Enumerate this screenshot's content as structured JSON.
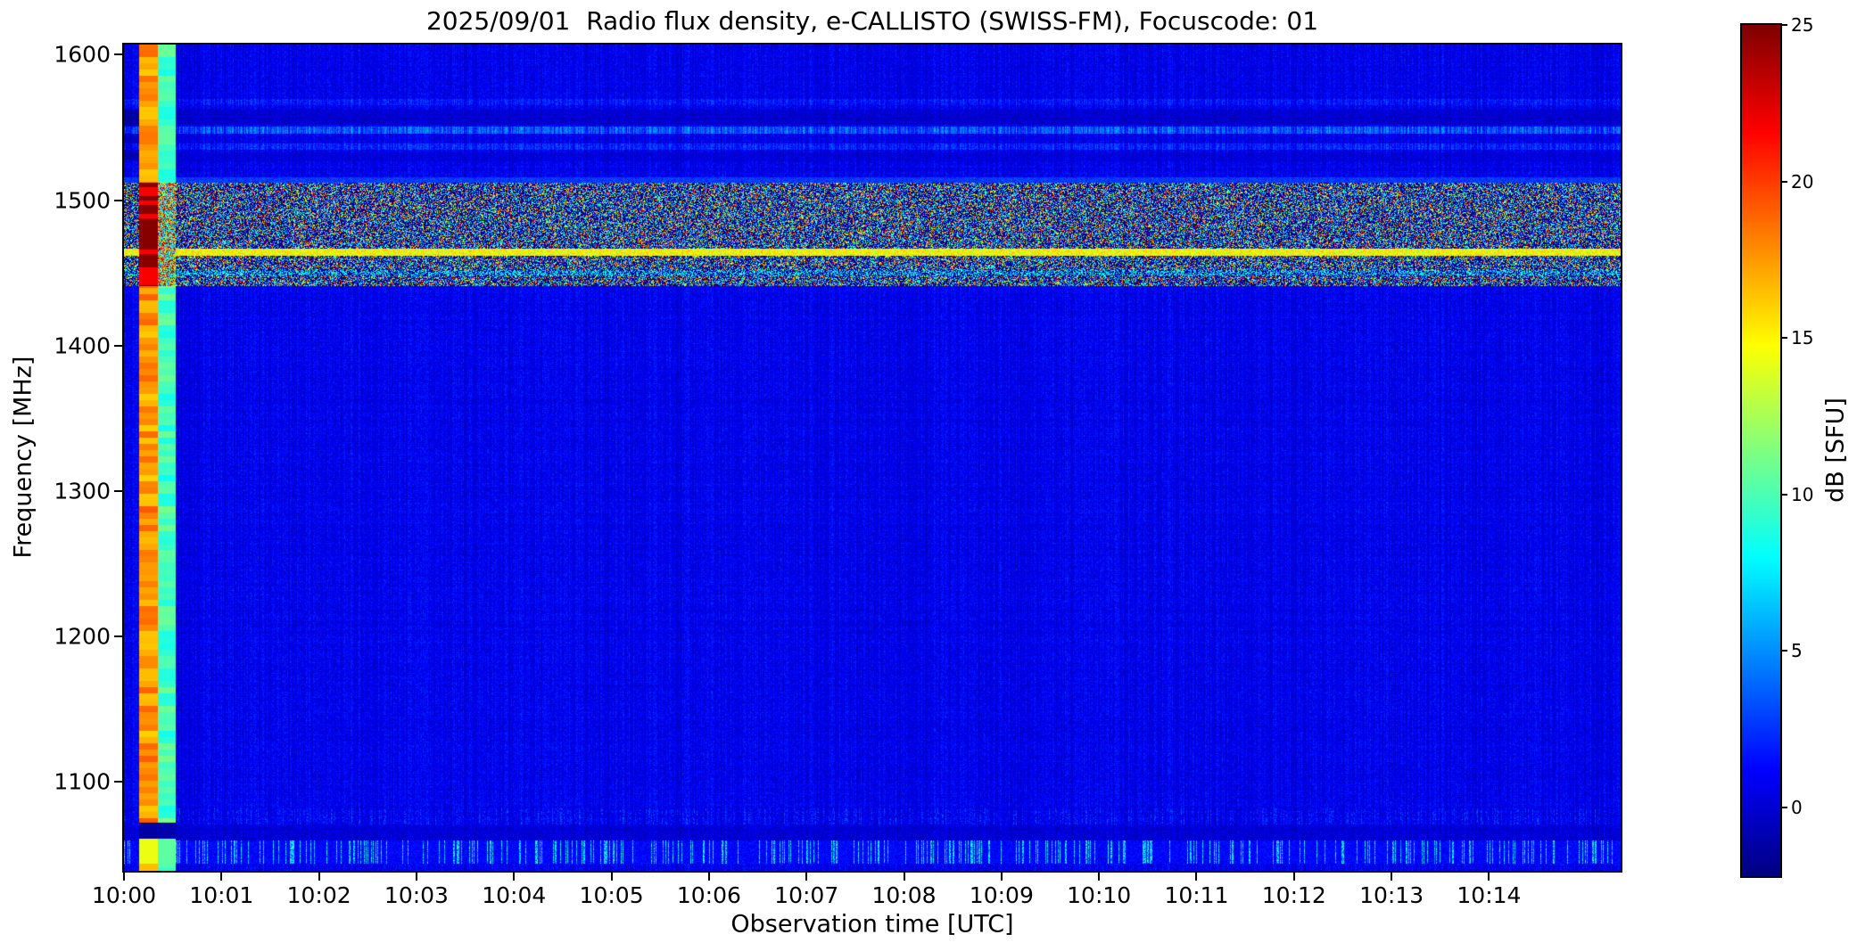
{
  "figure": {
    "title": "2025/09/01  Radio flux density, e-CALLISTO (SWISS-FM), Focuscode: 01",
    "xlabel": "Observation time [UTC]",
    "ylabel": "Frequency [MHz]",
    "colorbar_label": "dB [SFU]"
  },
  "chart_data": {
    "type": "heatmap",
    "title": "2025/09/01  Radio flux density, e-CALLISTO (SWISS-FM), Focuscode: 01",
    "xlabel": "Observation time [UTC]",
    "ylabel": "Frequency [MHz]",
    "x_tick_labels": [
      "10:00",
      "10:01",
      "10:02",
      "10:03",
      "10:04",
      "10:05",
      "10:06",
      "10:07",
      "10:08",
      "10:09",
      "10:10",
      "10:11",
      "10:12",
      "10:13",
      "10:14"
    ],
    "x_tick_minutes": [
      0,
      1,
      2,
      3,
      4,
      5,
      6,
      7,
      8,
      9,
      10,
      11,
      12,
      13,
      14
    ],
    "x_range_min": [
      0,
      15.35
    ],
    "y_tick_values": [
      1600,
      1500,
      1400,
      1300,
      1200,
      1100
    ],
    "y_range_mhz": [
      1039,
      1607
    ],
    "grid": false,
    "colorbar": {
      "label": "dB [SFU]",
      "tick_values": [
        0,
        5,
        10,
        15,
        20,
        25
      ],
      "range_db": [
        -2.2,
        25
      ],
      "colormap": "jet",
      "position": "right"
    },
    "background": {
      "mean_db": 0.7,
      "column_variation_db": 1.4,
      "pixel_noise_db": 2.4,
      "row_variation_db": 0.5
    },
    "features": {
      "pre_cal_dark_band": {
        "time_min": [
          0,
          0.16
        ],
        "freq_mhz": [
          1528,
          1562
        ],
        "boost_db": -1.2
      },
      "cal_stripe_main": {
        "time_min": [
          0.16,
          0.345
        ],
        "level_db": 17.6,
        "block_jitter_db": 1.6,
        "band_freq_mhz": [
          1441,
          1512
        ],
        "band_level_db": [
          21.8,
          24.8
        ],
        "gap_freq_mhz": [
          1061,
          1072
        ],
        "gap_level_db": -1.2,
        "bottom_freq_mhz": [
          1044,
          1061
        ],
        "bottom_level_db": 14.3,
        "below_level_db": 16.5
      },
      "cal_stripe_secondary": {
        "time_min": [
          0.345,
          0.53
        ],
        "level_db": 9.8,
        "block_jitter_db": 1.4,
        "band_freq_mhz": [
          1441,
          1512
        ],
        "band_speckle_fractions": [
          0.28,
          0.55
        ],
        "band_speckle_levels_db": [
          [
            22,
            25
          ],
          [
            13,
            20
          ],
          [
            5,
            11
          ]
        ],
        "gap_freq_mhz": [
          1061,
          1072
        ],
        "gap_level_db": -1.0,
        "bottom_freq_mhz": [
          1044,
          1061
        ],
        "bottom_level_db": 10.5
      },
      "interference_band": {
        "freq_mhz": [
          1441,
          1512
        ],
        "dark_level_db": [
          -2.2,
          -1.3
        ],
        "speckle_fractions": [
          0.48,
          0.75,
          0.93
        ],
        "speckle_levels_db": [
          [
            2.5,
            10.5
          ],
          [
            11,
            20
          ],
          [
            20,
            25
          ]
        ]
      },
      "carrier_line": {
        "freq_mhz": [
          1462,
          1466.5
        ],
        "level_db": [
          12.5,
          17
        ]
      },
      "secondary_line": {
        "freq_mhz": [
          1448.5,
          1452
        ],
        "level_db": [
          4.5,
          10.5
        ],
        "fill_fraction": 0.55
      },
      "band_top_edge": {
        "freq_mhz": [
          1512,
          1516
        ],
        "level_db": [
          1.8,
          3.6
        ]
      },
      "streaks": [
        {
          "freq_mhz": [
            1545.5,
            1550.5
          ],
          "boost_db": 2.6
        },
        {
          "freq_mhz": [
            1535,
            1539
          ],
          "boost_db": 1.3
        },
        {
          "freq_mhz": [
            1552,
            1562
          ],
          "boost_db": -0.8
        },
        {
          "freq_mhz": [
            1527,
            1533
          ],
          "boost_db": -0.5
        },
        {
          "freq_mhz": [
            1565.5,
            1569.5
          ],
          "boost_db": 0.9
        },
        {
          "freq_mhz": [
            1060,
            1070
          ],
          "boost_db": -0.6
        }
      ],
      "bottom_interference": {
        "freq_mhz": [
          1044,
          1060
        ],
        "streak_fraction": 0.2,
        "streak_level_db": [
          3,
          10
        ],
        "base_level_db": [
          0.3,
          2.1
        ]
      },
      "faint_bottom_streaks": {
        "freq_mhz": [
          1071,
          1082
        ],
        "streak_fraction": 0.3,
        "boost_db": 1.6
      }
    }
  }
}
